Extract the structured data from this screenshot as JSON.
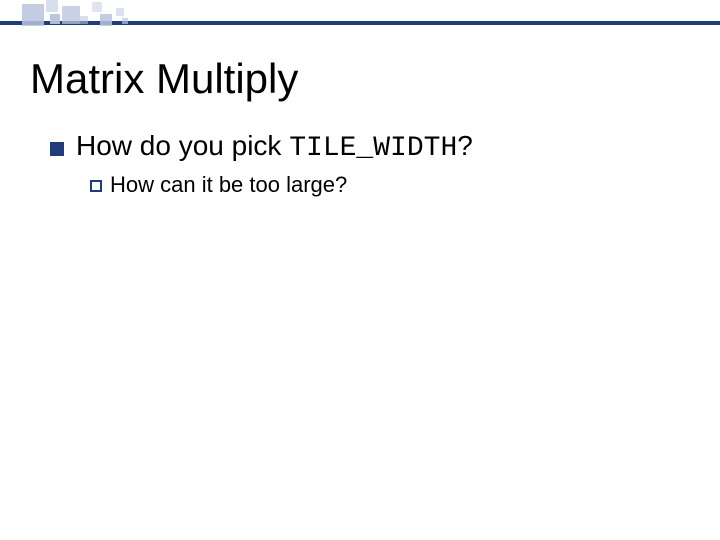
{
  "slide": {
    "title": "Matrix Multiply",
    "bullet1": {
      "prefix": "How do you pick ",
      "code": "TILE_WIDTH",
      "suffix": "?"
    },
    "bullet2": "How can it be too large?"
  },
  "decor": {
    "bar_color": "#1f3d7a",
    "squares": [
      {
        "l": 22,
        "t": 4,
        "w": 22,
        "h": 22,
        "op": 0.85
      },
      {
        "l": 46,
        "t": 0,
        "w": 12,
        "h": 12,
        "op": 0.55
      },
      {
        "l": 50,
        "t": 14,
        "w": 10,
        "h": 10,
        "op": 0.95
      },
      {
        "l": 62,
        "t": 6,
        "w": 18,
        "h": 18,
        "op": 0.75
      },
      {
        "l": 80,
        "t": 16,
        "w": 8,
        "h": 8,
        "op": 0.55
      },
      {
        "l": 92,
        "t": 2,
        "w": 10,
        "h": 10,
        "op": 0.45
      },
      {
        "l": 100,
        "t": 14,
        "w": 12,
        "h": 12,
        "op": 0.85
      },
      {
        "l": 116,
        "t": 8,
        "w": 8,
        "h": 8,
        "op": 0.5
      },
      {
        "l": 122,
        "t": 18,
        "w": 6,
        "h": 6,
        "op": 0.7
      }
    ]
  }
}
